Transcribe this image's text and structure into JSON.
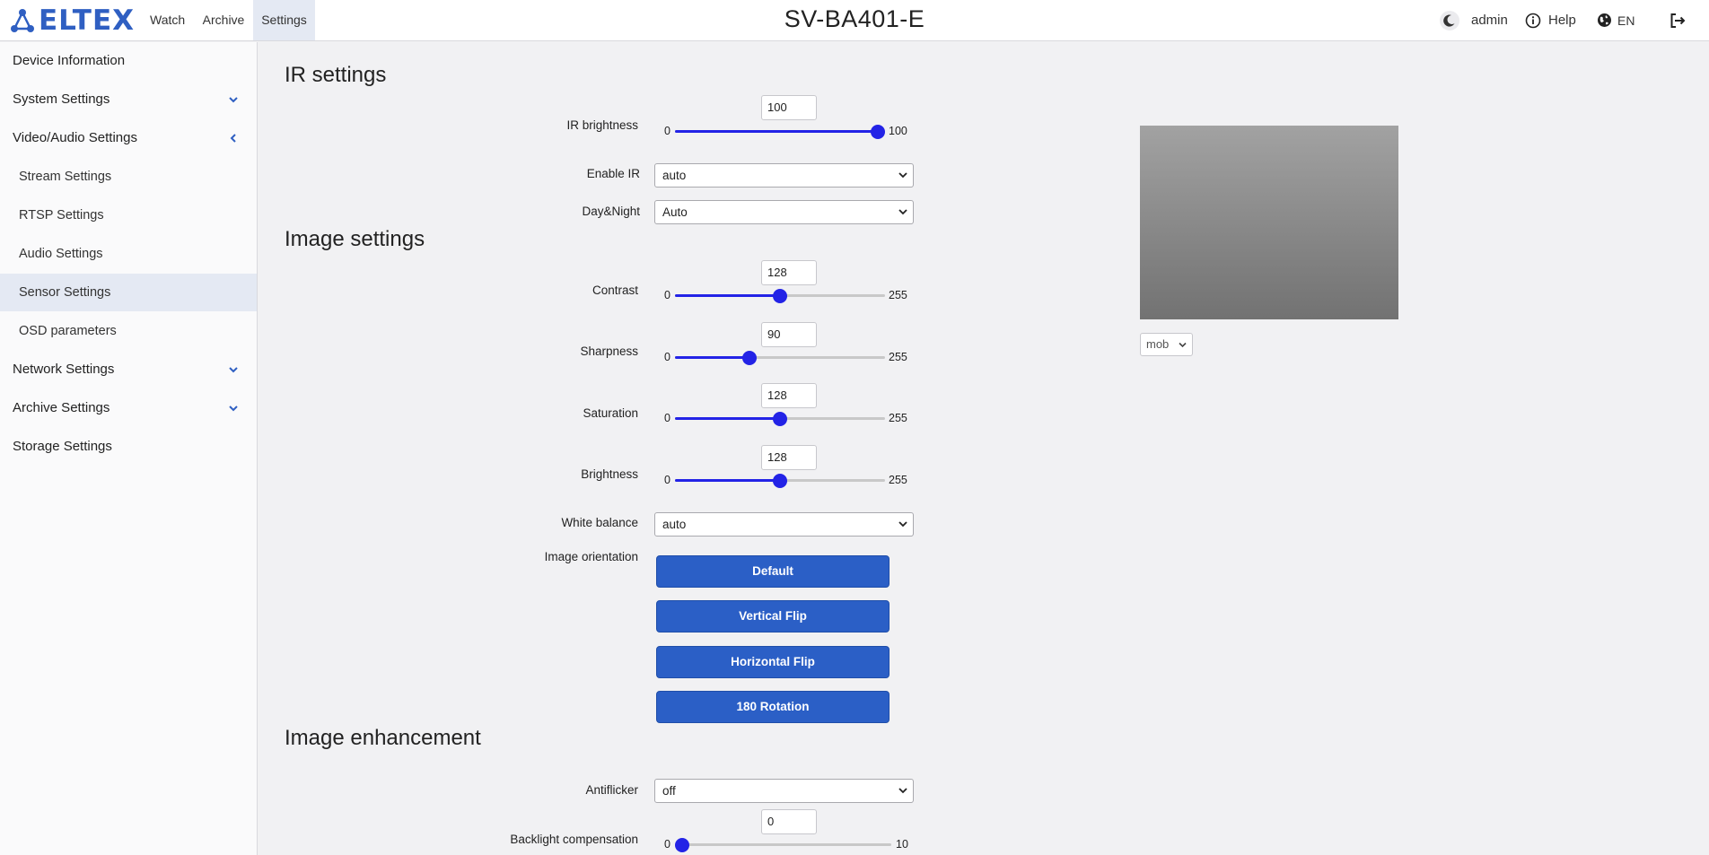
{
  "header": {
    "logo_text": "ELTEX",
    "nav": [
      {
        "label": "Watch"
      },
      {
        "label": "Archive"
      },
      {
        "label": "Settings",
        "active": true
      }
    ],
    "title": "SV-BA401-E",
    "user": "admin",
    "help": "Help",
    "language": "EN",
    "icons": [
      "theme-moon-icon",
      "info-icon",
      "globe-icon",
      "logout-icon"
    ],
    "accent_color": "#2f5fc2"
  },
  "sidebar": {
    "items": [
      {
        "label": "Device Information",
        "level": 0
      },
      {
        "label": "System Settings",
        "level": 0,
        "chevron": "down"
      },
      {
        "label": "Video/Audio Settings",
        "level": 0,
        "chevron": "left"
      },
      {
        "label": "Stream Settings",
        "level": 1
      },
      {
        "label": "RTSP Settings",
        "level": 1
      },
      {
        "label": "Audio Settings",
        "level": 1
      },
      {
        "label": "Sensor Settings",
        "level": 1,
        "active": true
      },
      {
        "label": "OSD parameters",
        "level": 1
      },
      {
        "label": "Network Settings",
        "level": 0,
        "chevron": "down"
      },
      {
        "label": "Archive Settings",
        "level": 0,
        "chevron": "down"
      },
      {
        "label": "Storage Settings",
        "level": 0
      }
    ]
  },
  "sections": {
    "ir": "IR settings",
    "image": "Image settings",
    "enhancement": "Image enhancement"
  },
  "ir": {
    "brightness": {
      "label": "IR brightness",
      "value": "100",
      "min": "0",
      "max": "100",
      "fraction": 1.0
    },
    "enable_ir": {
      "label": "Enable IR",
      "value": "auto"
    },
    "day_night": {
      "label": "Day&Night",
      "value": "Auto"
    }
  },
  "image": {
    "contrast": {
      "label": "Contrast",
      "value": "128",
      "min": "0",
      "max": "255",
      "fraction": 0.502
    },
    "sharpness": {
      "label": "Sharpness",
      "value": "90",
      "min": "0",
      "max": "255",
      "fraction": 0.353
    },
    "saturation": {
      "label": "Saturation",
      "value": "128",
      "min": "0",
      "max": "255",
      "fraction": 0.502
    },
    "brightness": {
      "label": "Brightness",
      "value": "128",
      "min": "0",
      "max": "255",
      "fraction": 0.502
    },
    "white_balance": {
      "label": "White balance",
      "value": "auto"
    },
    "orientation": {
      "label": "Image orientation",
      "buttons": [
        "Default",
        "Vertical Flip",
        "Horizontal Flip",
        "180 Rotation"
      ]
    }
  },
  "enhancement": {
    "antiflicker": {
      "label": "Antiflicker",
      "value": "off"
    },
    "backlight": {
      "label": "Backlight compensation",
      "value": "0",
      "min": "0",
      "max": "10",
      "fraction": 0.0
    }
  },
  "preview": {
    "stream_select": "mob"
  },
  "colors": {
    "slider": "#2323e6",
    "button": "#2b5fc6",
    "active_bg": "#e4e9f3"
  }
}
